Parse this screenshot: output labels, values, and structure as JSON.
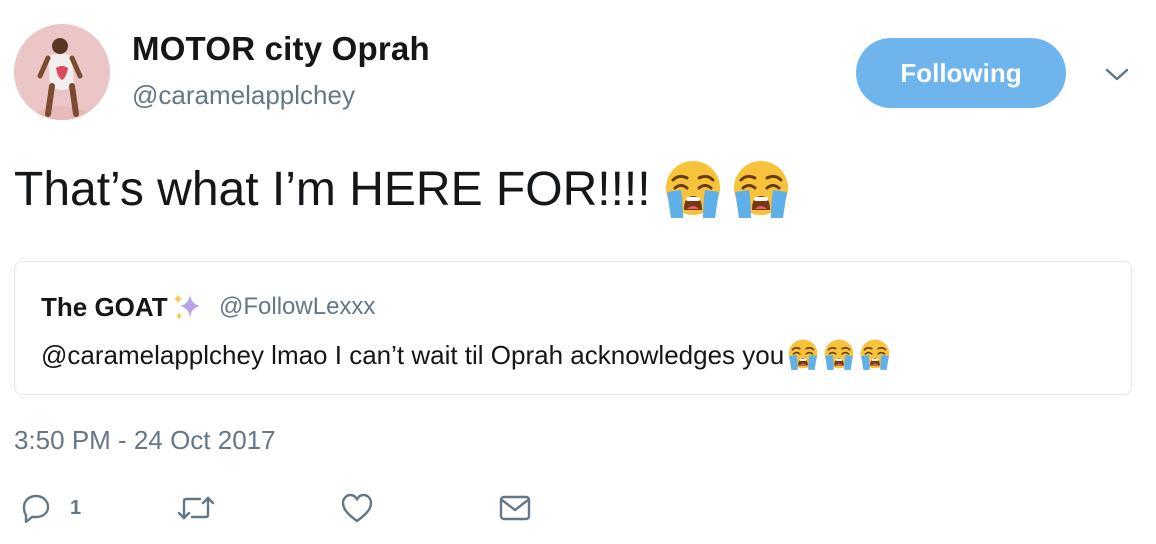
{
  "author": {
    "display_name": "MOTOR city Oprah",
    "handle": "@caramelapplchey"
  },
  "follow_button": {
    "label": "Following",
    "color": "#6eb5ee"
  },
  "tweet": {
    "text": "That’s what I’m HERE FOR!!!!",
    "emojis": [
      "loudly-crying-face-icon",
      "loudly-crying-face-icon"
    ]
  },
  "quoted_tweet": {
    "display_name": "The GOAT",
    "name_emoji": "sparkles-icon",
    "handle": "@FollowLexxx",
    "text": "@caramelapplchey lmao I can’t wait til Oprah acknowledges you",
    "emojis": [
      "loudly-crying-face-icon",
      "loudly-crying-face-icon",
      "loudly-crying-face-icon"
    ]
  },
  "timestamp": "3:50 PM - 24 Oct 2017",
  "actions": {
    "reply_count": "1",
    "icons": [
      "reply-icon",
      "retweet-icon",
      "like-icon",
      "direct-message-icon"
    ]
  },
  "colors": {
    "text": "#14171a",
    "secondary": "#657786",
    "border": "#e1e8ed",
    "accent": "#6eb5ee"
  }
}
